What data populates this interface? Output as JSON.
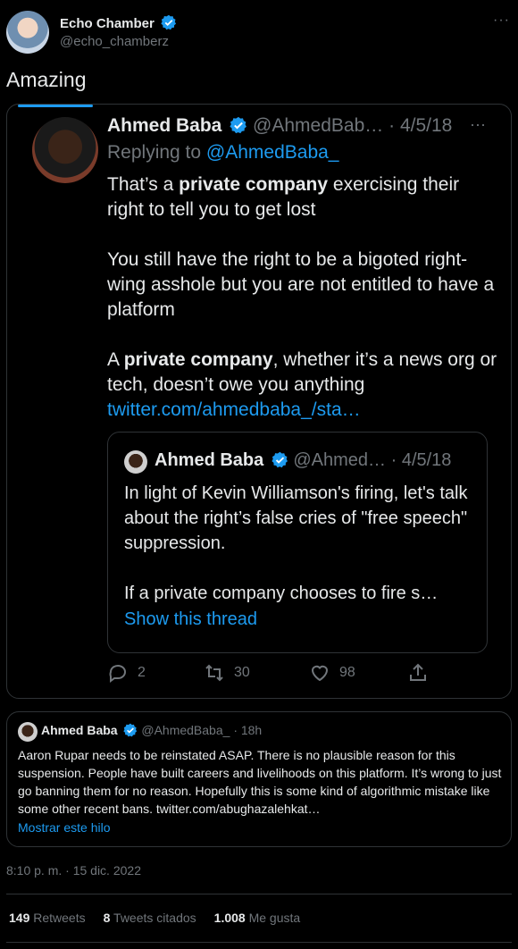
{
  "author": {
    "name": "Echo Chamber",
    "handle": "@echo_chamberz"
  },
  "tweet": {
    "text": "Amazing"
  },
  "quoted_tweet": {
    "name": "Ahmed Baba",
    "handle": "@AhmedBab…",
    "date": "· 4/5/18",
    "replying_prefix": "Replying to",
    "replying_to": "@AhmedBaba_",
    "p1_pre": "That’s a ",
    "p1_bold": "private company",
    "p1_post": " exercising  their right to tell you to get lost",
    "p2": "You still have the right to be a bigoted right-wing asshole but you are not entitled to have a platform",
    "p3_pre": "A ",
    "p3_bold": "private company",
    "p3_post": ", whether it’s a news org or tech, doesn’t owe you anything",
    "link": "twitter.com/ahmedbaba_/sta…",
    "inner": {
      "name": "Ahmed Baba",
      "handle": "@Ahmed…",
      "date": "· 4/5/18",
      "p1": "In light of Kevin Williamson's firing, let's talk about the right’s false cries of \"free speech\" suppression.",
      "p2": "If a private company chooses to fire s…",
      "show_thread": "Show this thread"
    },
    "actions": {
      "replies": "2",
      "retweets": "30",
      "likes": "98"
    }
  },
  "quoted_tweet_2": {
    "name": "Ahmed Baba",
    "handle": "@AhmedBaba_",
    "time": "· 18h",
    "text": "Aaron Rupar needs to be reinstated ASAP. There is no plausible reason for this suspension. People have built careers and livelihoods on this platform. It’s wrong to just go banning them for no reason. Hopefully this is some kind of algorithmic mistake like some other recent bans. twitter.com/abughazalehkat…",
    "show_thread": "Mostrar este hilo"
  },
  "timestamp": "8:10 p. m. · 15 dic. 2022",
  "stats": [
    {
      "num": "149",
      "label": "Retweets"
    },
    {
      "num": "8",
      "label": "Tweets citados"
    },
    {
      "num": "1.008",
      "label": "Me gusta"
    }
  ],
  "colors": {
    "accent": "#1d9bf0",
    "muted": "#71767b",
    "border": "#2f3336"
  },
  "icons": [
    "verified-icon",
    "more-icon",
    "reply-icon",
    "retweet-icon",
    "like-icon",
    "share-icon"
  ]
}
